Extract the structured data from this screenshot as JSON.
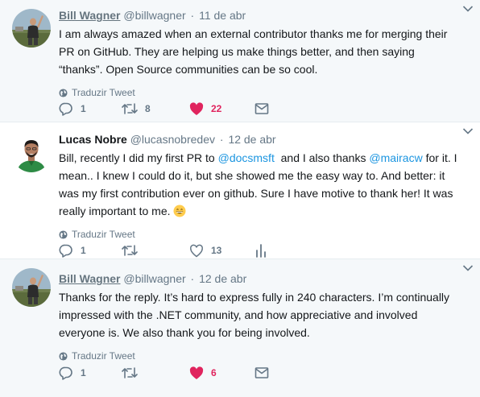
{
  "tweets": [
    {
      "author_name": "Bill Wagner",
      "handle": "@billwagner",
      "separator": "·",
      "date": "11 de abr",
      "text_parts": [
        {
          "t": "I am always amazed when an external contributor thanks me for merging their PR on GitHub. They are helping us make things better, and then saying “thanks”. Open Source communities can be so cool.",
          "mention": false
        }
      ],
      "translate": "Traduzir Tweet",
      "replies": "1",
      "retweets": "8",
      "likes": "22",
      "liked": true,
      "last_icon": "mail-icon"
    },
    {
      "author_name": "Lucas Nobre",
      "handle": "@lucasnobredev",
      "separator": "·",
      "date": "12 de abr",
      "text_parts": [
        {
          "t": "Bill, recently I did my first PR to ",
          "mention": false
        },
        {
          "t": "@docsmsft",
          "mention": true
        },
        {
          "t": "  and I also thanks ",
          "mention": false
        },
        {
          "t": "@mairacw",
          "mention": true
        },
        {
          "t": " for it. I mean.. I knew I could do it, but she showed me the easy way to. And better: it was my first contribution ever on github. Sure I have motive to thank her! It was really important to me. ",
          "mention": false
        }
      ],
      "emoji_icon": "grinning-face-icon",
      "translate": "Traduzir Tweet",
      "replies": "1",
      "retweets": "",
      "likes": "13",
      "liked": false,
      "last_icon": "analytics-icon"
    },
    {
      "author_name": "Bill Wagner",
      "handle": "@billwagner",
      "separator": "·",
      "date": "12 de abr",
      "text_parts": [
        {
          "t": "Thanks for the reply. It’s hard to express fully in 240 characters. I’m continually impressed with the .NET community, and how appreciative and involved everyone is. We also thank you for being involved.",
          "mention": false
        }
      ],
      "translate": "Traduzir Tweet",
      "replies": "1",
      "retweets": "",
      "likes": "6",
      "liked": true,
      "last_icon": "mail-icon"
    }
  ],
  "colors": {
    "like_active": "#e0245e",
    "mention": "#1b95e0",
    "muted": "#657786",
    "text": "#14171a"
  }
}
